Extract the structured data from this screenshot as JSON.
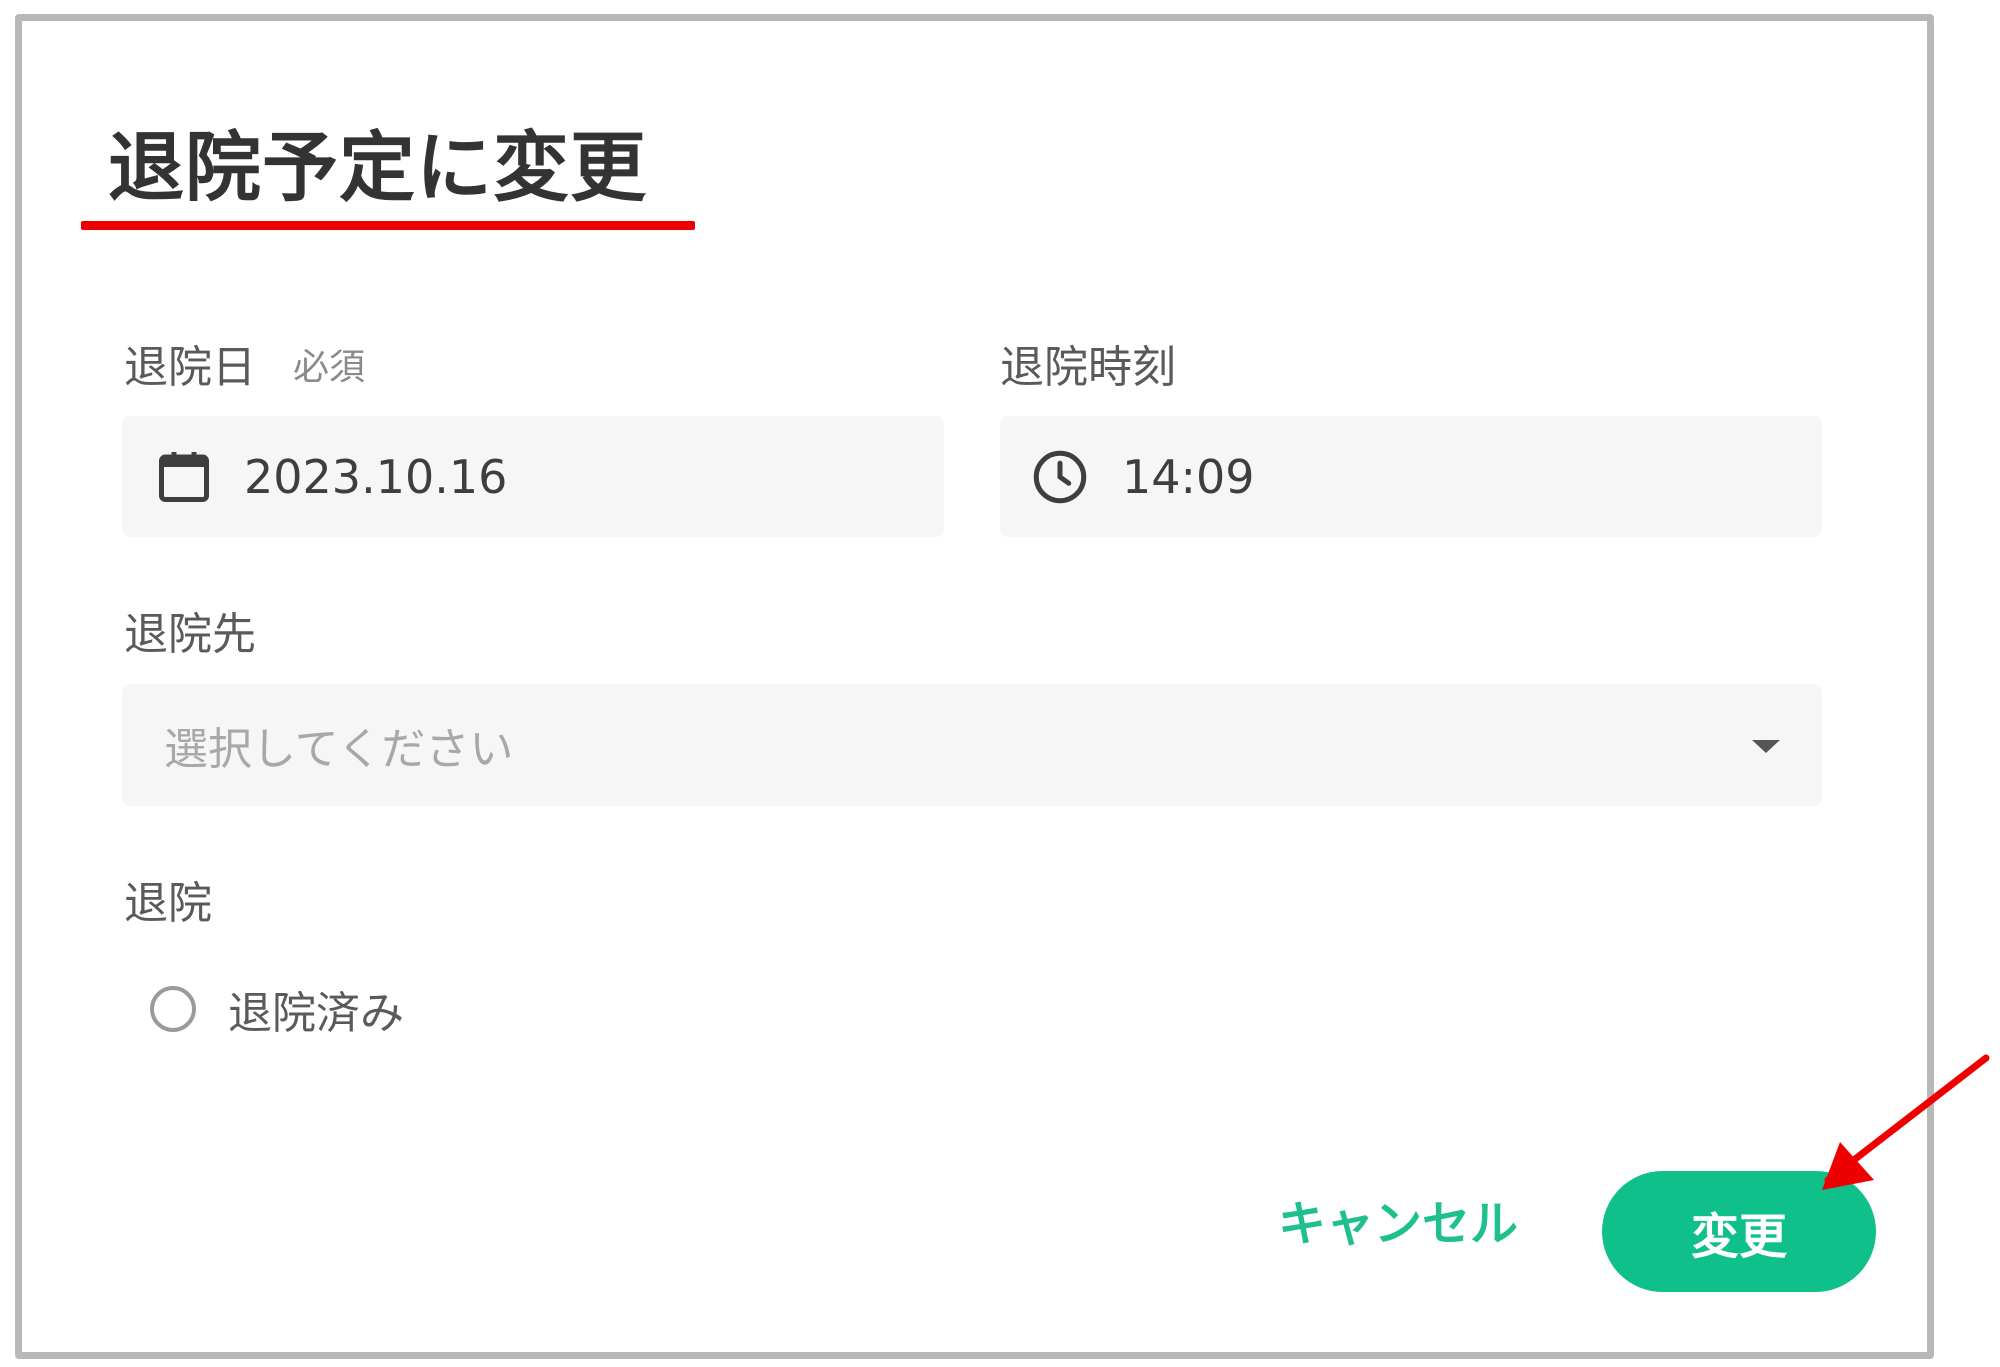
{
  "dialog": {
    "title": "退院予定に変更",
    "highlight_color": "#ee0000"
  },
  "form": {
    "discharge_date": {
      "label": "退院日",
      "required_label": "必須",
      "value": "2023.10.16",
      "icon": "calendar-icon"
    },
    "discharge_time": {
      "label": "退院時刻",
      "value": "14:09",
      "icon": "clock-icon"
    },
    "destination": {
      "label": "退院先",
      "placeholder": "選択してください",
      "icon": "chevron-down-icon"
    },
    "discharge": {
      "label": "退院",
      "option_label": "退院済み",
      "checked": false
    }
  },
  "actions": {
    "cancel_label": "キャンセル",
    "confirm_label": "変更",
    "accent_color": "#0fc08b",
    "annotation_arrow_color": "#ee0000"
  }
}
